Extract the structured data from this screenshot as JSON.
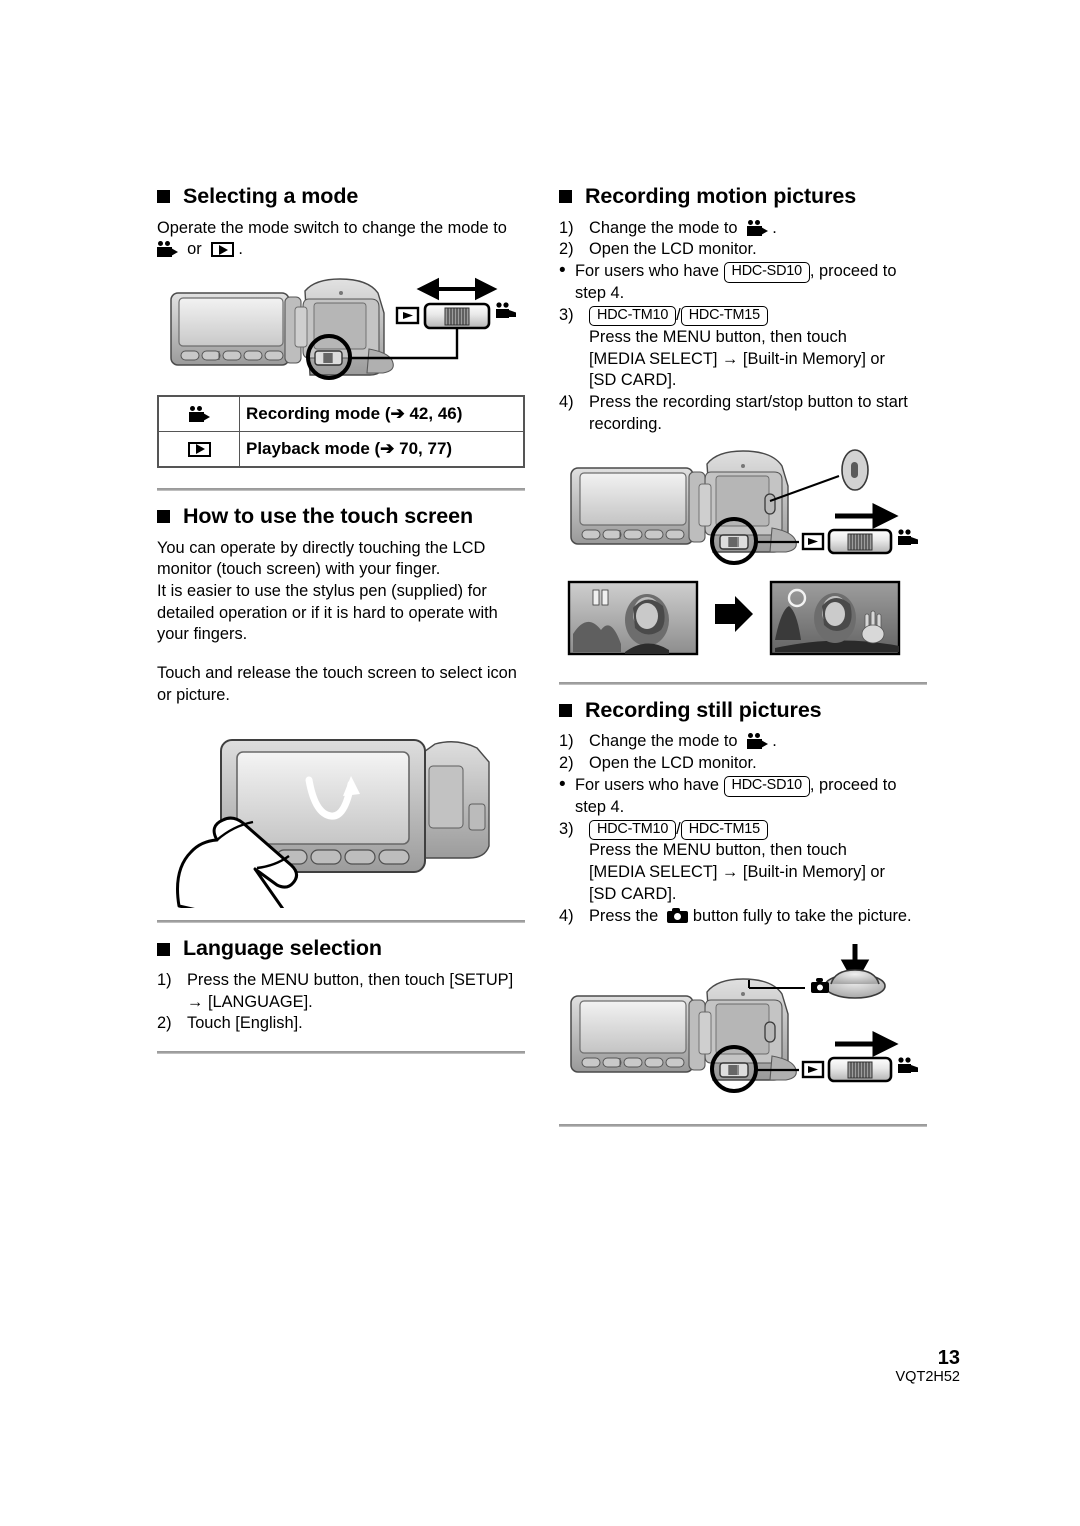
{
  "document": {
    "page_number": "13",
    "doc_code": "VQT2H52"
  },
  "left_column": {
    "selecting_mode": {
      "heading": "Selecting a mode",
      "intro_line1": "Operate the mode switch to change the mode to",
      "intro_or": "or",
      "intro_period": ".",
      "table": {
        "rows": [
          {
            "icon": "camcorder-icon",
            "label": "Recording mode (➔ 42, 46)"
          },
          {
            "icon": "play-icon",
            "label": "Playback mode (➔ 70, 77)"
          }
        ]
      }
    },
    "touch_screen": {
      "heading": "How to use the touch screen",
      "paragraph1": "You can operate by directly touching the LCD monitor (touch screen) with your finger.",
      "paragraph2": "It is easier to use the stylus pen (supplied) for detailed operation or if it is hard to operate with your fingers.",
      "paragraph3": "Touch and release the touch screen to select icon or picture."
    },
    "language_selection": {
      "heading": "Language selection",
      "steps": [
        {
          "num": "1)",
          "text": "Press the MENU button, then touch [SETUP]"
        },
        {
          "num": "",
          "text": "→ [LANGUAGE]."
        },
        {
          "num": "2)",
          "text": "Touch [English]."
        }
      ]
    }
  },
  "right_column": {
    "recording_motion": {
      "heading": "Recording motion pictures",
      "step1_num": "1)",
      "step1_text_a": "Change the mode to",
      "step1_text_b": ".",
      "step2_num": "2)",
      "step2_text": "Open the LCD monitor.",
      "bullet_text_a": "For users who have",
      "bullet_badge": "HDC-SD10",
      "bullet_text_b": ", proceed to",
      "bullet_text_c": "step 4.",
      "step3_num": "3)",
      "step3_badge1": "HDC-TM10",
      "step3_slash": "/",
      "step3_badge2": "HDC-TM15",
      "step3_line1": "Press the MENU button, then touch",
      "step3_line2": "[MEDIA SELECT] → [Built-in Memory] or",
      "step3_line3": "[SD CARD].",
      "step4_num": "4)",
      "step4_text": "Press the recording start/stop button to start recording."
    },
    "recording_still": {
      "heading": "Recording still pictures",
      "step1_num": "1)",
      "step1_text_a": "Change the mode to",
      "step1_text_b": ".",
      "step2_num": "2)",
      "step2_text": "Open the LCD monitor.",
      "bullet_text_a": "For users who have",
      "bullet_badge": "HDC-SD10",
      "bullet_text_b": ", proceed to",
      "bullet_text_c": "step 4.",
      "step3_num": "3)",
      "step3_badge1": "HDC-TM10",
      "step3_slash": "/",
      "step3_badge2": "HDC-TM15",
      "step3_line1": "Press the MENU button, then touch",
      "step3_line2": "[MEDIA SELECT] → [Built-in Memory] or",
      "step3_line3": "[SD CARD].",
      "step4_num": "4)",
      "step4_text_a": "Press the",
      "step4_text_b": "button fully to take the picture."
    }
  }
}
